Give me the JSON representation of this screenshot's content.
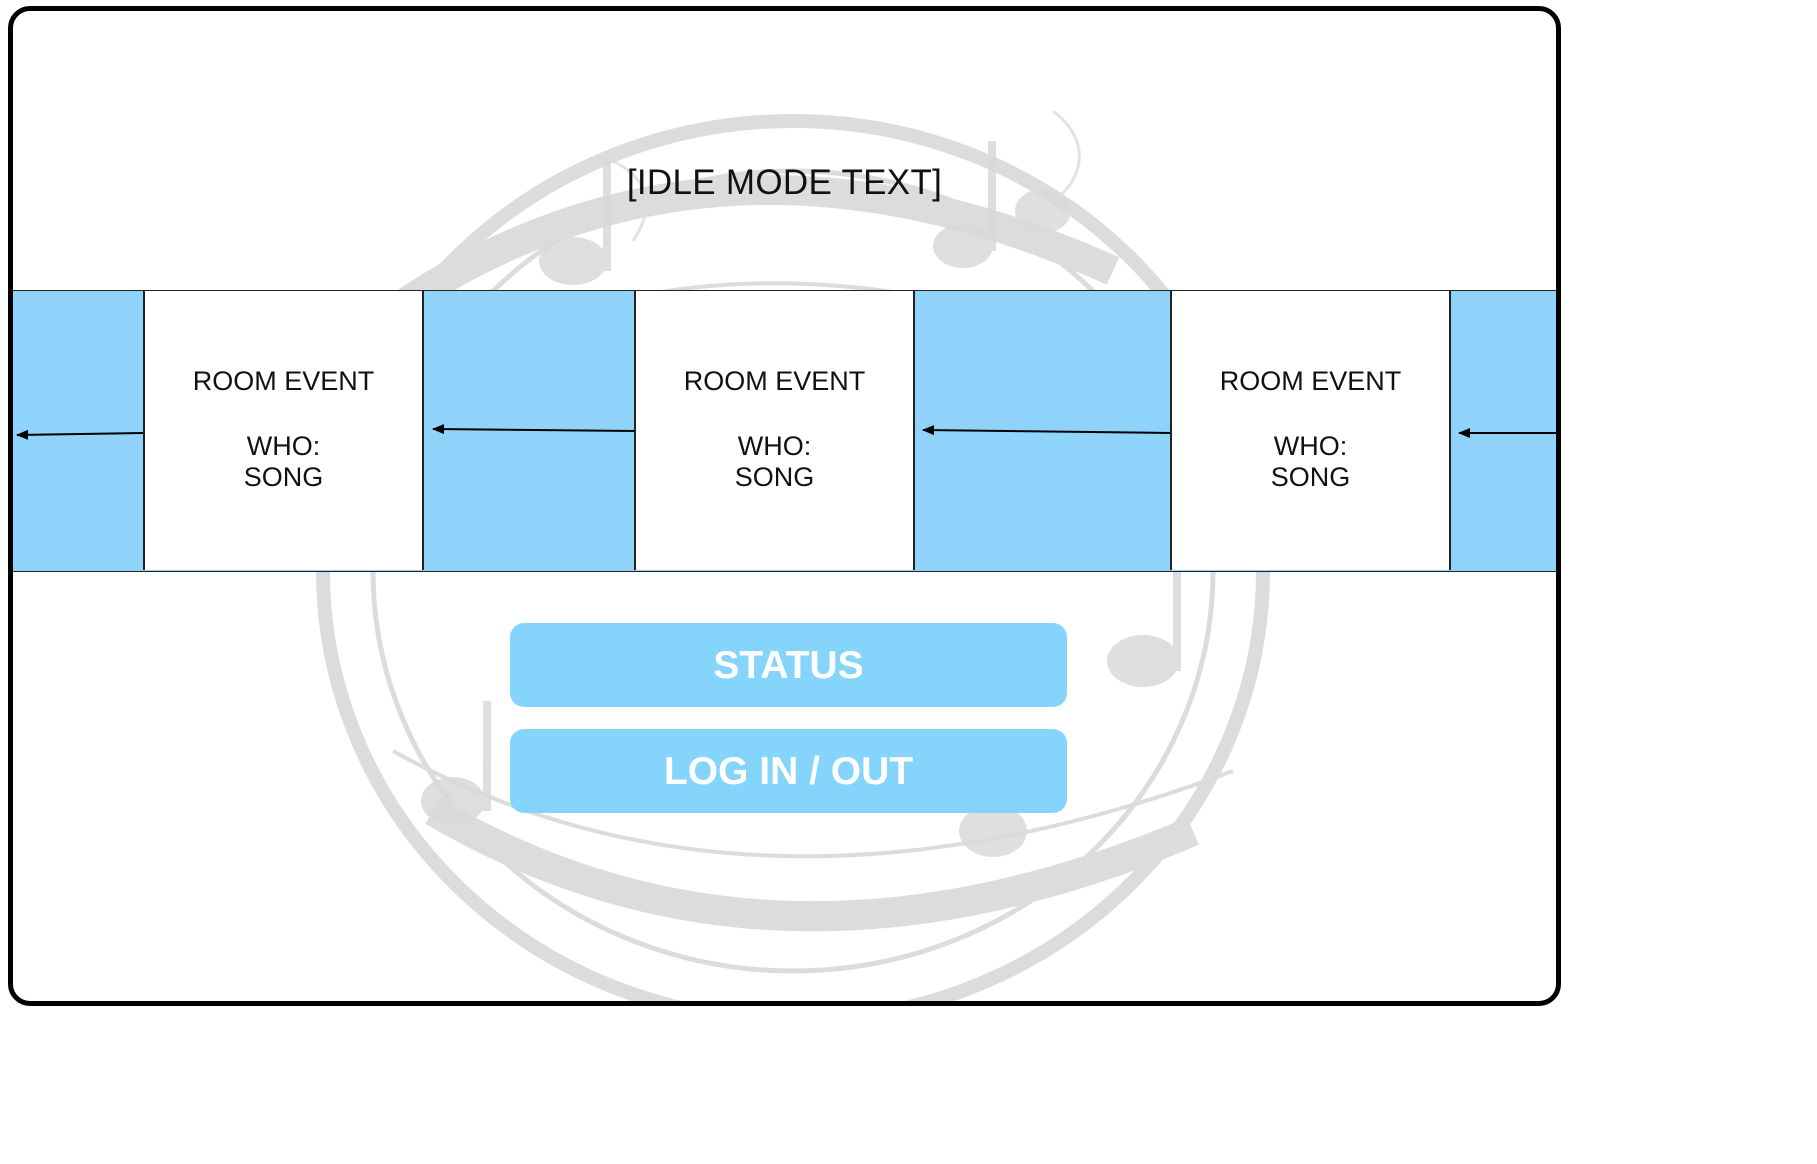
{
  "idle_mode_text": "[IDLE MODE TEXT]",
  "events": [
    {
      "title": "ROOM EVENT",
      "who": "WHO:",
      "song": "SONG"
    },
    {
      "title": "ROOM EVENT",
      "who": "WHO:",
      "song": "SONG"
    },
    {
      "title": "ROOM EVENT",
      "who": "WHO:",
      "song": "SONG"
    }
  ],
  "buttons": {
    "status_label": "STATUS",
    "login_label": "LOG IN / OUT"
  },
  "colors": {
    "strip_blue": "#8fd3fb",
    "button_blue": "#85d4fb",
    "frame": "#000000"
  }
}
